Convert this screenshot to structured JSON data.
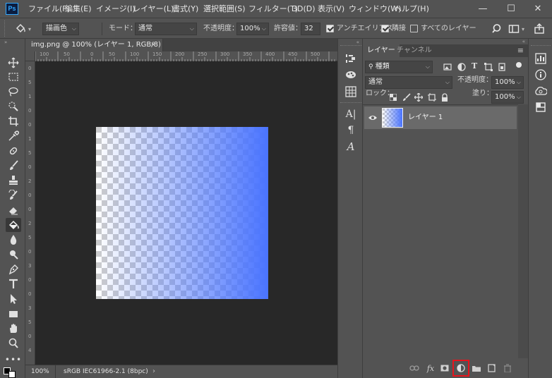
{
  "menubar": {
    "logo": "Ps",
    "items": [
      "ファイル(F)",
      "編集(E)",
      "イメージ(I)",
      "レイヤー(L)",
      "書式(Y)",
      "選択範囲(S)",
      "フィルター(T)",
      "3D(D)",
      "表示(V)",
      "ウィンドウ(W)",
      "ヘルプ(H)"
    ],
    "win_minimize": "—",
    "win_maximize": "☐",
    "win_close": "✕"
  },
  "options": {
    "fill_source": "描画色",
    "mode_label": "モード：",
    "mode_value": "通常",
    "opacity_label": "不透明度：",
    "opacity_value": "100%",
    "tolerance_label": "許容値：",
    "tolerance_value": "32",
    "antialias_label": "アンチエイリアス",
    "antialias_checked": true,
    "contiguous_label": "隣接",
    "contiguous_checked": true,
    "all_layers_label": "すべてのレイヤー",
    "all_layers_checked": false
  },
  "document": {
    "tab_title": "img.png @ 100% (レイヤー 1, RGB/8)",
    "tab_close": "×",
    "ruler_top": [
      "100",
      "50",
      "0",
      "50",
      "100",
      "150",
      "200",
      "250",
      "300",
      "350",
      "400",
      "450",
      "500"
    ],
    "ruler_left": [
      "0",
      "5",
      "1",
      "0",
      "0",
      "1",
      "5",
      "0",
      "2",
      "0",
      "0",
      "2",
      "5",
      "0",
      "3",
      "0",
      "0",
      "3",
      "5",
      "0",
      "4"
    ],
    "zoom": "100%",
    "color_profile": "sRGB IEC61966-2.1 (8bpc)",
    "status_arrow": "›",
    "gradient_color": "#4a74ff"
  },
  "layers_panel": {
    "tabs": [
      "レイヤー",
      "チャンネル"
    ],
    "filter_kind": "種類",
    "blend_mode": "通常",
    "opacity_label": "不透明度：",
    "opacity_value": "100%",
    "lock_label": "ロック：",
    "fill_label": "塗り：",
    "fill_value": "100%",
    "layers": [
      {
        "name": "レイヤー 1",
        "visible": true,
        "selected": true
      }
    ],
    "highlight_color": "#e8141c"
  }
}
